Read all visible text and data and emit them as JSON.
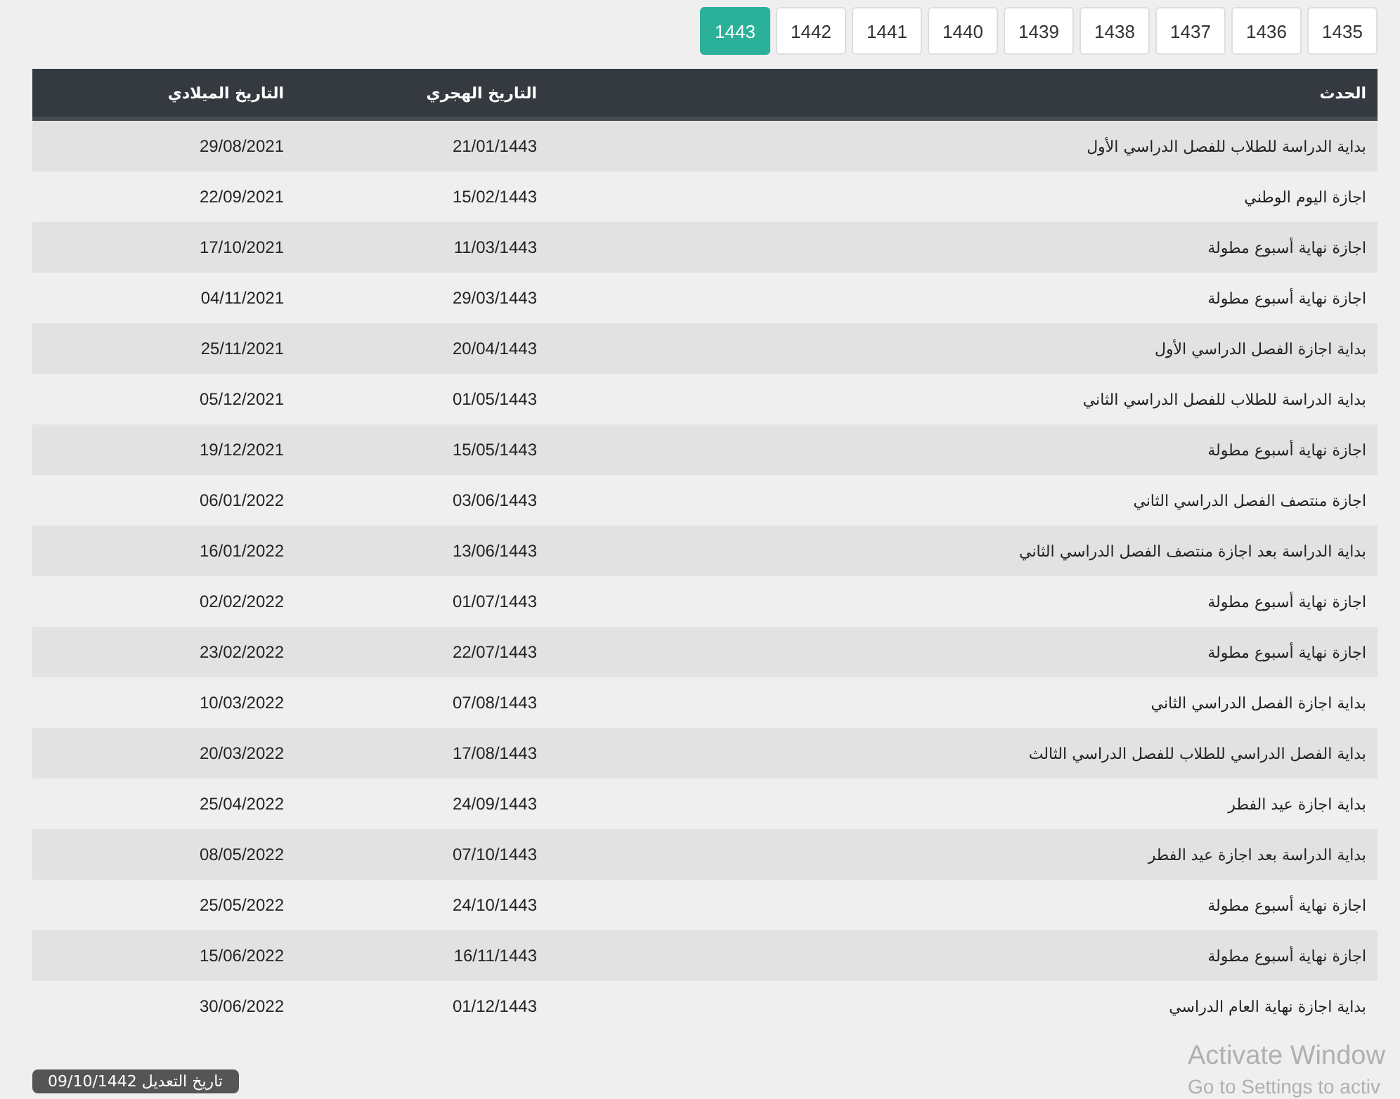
{
  "year_tabs": [
    {
      "label": "1435",
      "selected": false
    },
    {
      "label": "1436",
      "selected": false
    },
    {
      "label": "1437",
      "selected": false
    },
    {
      "label": "1438",
      "selected": false
    },
    {
      "label": "1439",
      "selected": false
    },
    {
      "label": "1440",
      "selected": false
    },
    {
      "label": "1441",
      "selected": false
    },
    {
      "label": "1442",
      "selected": false
    },
    {
      "label": "1443",
      "selected": true
    }
  ],
  "table": {
    "columns": [
      "الحدث",
      "التاريخ الهجري",
      "التاريخ الميلادي"
    ],
    "rows": [
      [
        "بداية الدراسة للطلاب للفصل الدراسي الأول",
        "21/01/1443",
        "29/08/2021"
      ],
      [
        "اجازة اليوم الوطني",
        "15/02/1443",
        "22/09/2021"
      ],
      [
        "اجازة نهاية أسبوع مطولة",
        "11/03/1443",
        "17/10/2021"
      ],
      [
        "اجازة نهاية أسبوع مطولة",
        "29/03/1443",
        "04/11/2021"
      ],
      [
        "بداية اجازة الفصل الدراسي الأول",
        "20/04/1443",
        "25/11/2021"
      ],
      [
        "بداية الدراسة للطلاب للفصل الدراسي الثاني",
        "01/05/1443",
        "05/12/2021"
      ],
      [
        "اجازة نهاية أسبوع مطولة",
        "15/05/1443",
        "19/12/2021"
      ],
      [
        "اجازة منتصف الفصل الدراسي الثاني",
        "03/06/1443",
        "06/01/2022"
      ],
      [
        "بداية الدراسة بعد اجازة منتصف الفصل الدراسي الثاني",
        "13/06/1443",
        "16/01/2022"
      ],
      [
        "اجازة نهاية أسبوع مطولة",
        "01/07/1443",
        "02/02/2022"
      ],
      [
        "اجازة نهاية أسبوع مطولة",
        "22/07/1443",
        "23/02/2022"
      ],
      [
        "بداية اجازة الفصل الدراسي الثاني",
        "07/08/1443",
        "10/03/2022"
      ],
      [
        "بداية الفصل الدراسي للطلاب للفصل الدراسي الثالث",
        "17/08/1443",
        "20/03/2022"
      ],
      [
        "بداية اجازة عيد الفطر",
        "24/09/1443",
        "25/04/2022"
      ],
      [
        "بداية الدراسة بعد اجازة عيد الفطر",
        "07/10/1443",
        "08/05/2022"
      ],
      [
        "اجازة نهاية أسبوع مطولة",
        "24/10/1443",
        "25/05/2022"
      ],
      [
        "اجازة نهاية أسبوع مطولة",
        "16/11/1443",
        "15/06/2022"
      ],
      [
        "بداية اجازة نهاية العام الدراسي",
        "01/12/1443",
        "30/06/2022"
      ]
    ]
  },
  "updated_badge": "تاريخ التعديل 09/10/1442",
  "os_notice": {
    "title": "Activate Window",
    "subtitle": "Go to Settings to activ"
  }
}
